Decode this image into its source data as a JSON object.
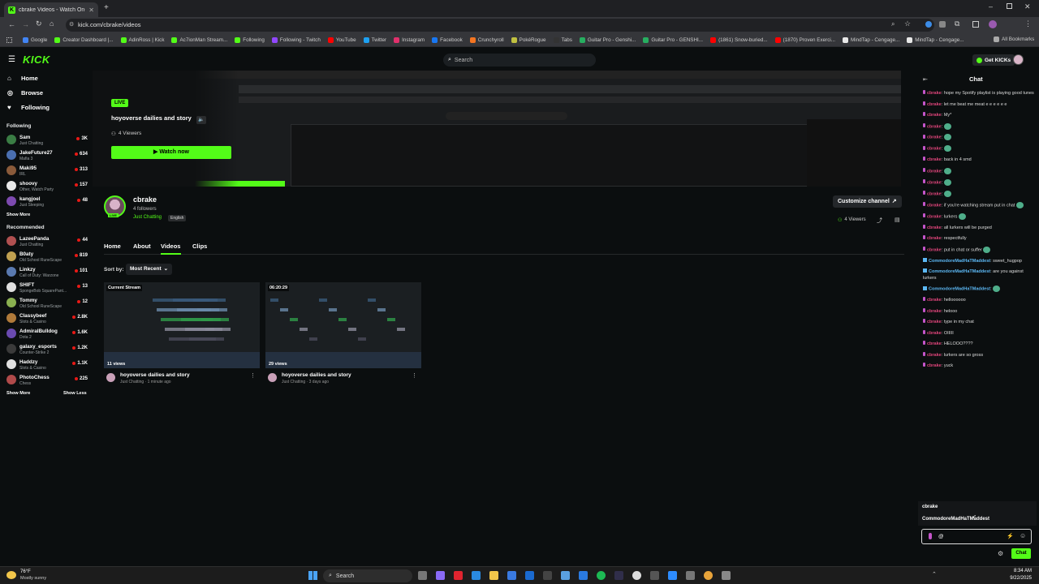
{
  "browser": {
    "tab_title": "cbrake Videos - Watch On-Der",
    "url": "kick.com/cbrake/videos",
    "bookmarks": [
      "Google",
      "Creator Dashboard |...",
      "AdinRoss | Kick",
      "Ac7ionMan Stream...",
      "Following",
      "Following - Twitch",
      "YouTube",
      "Twitter",
      "Instagram",
      "Facebook",
      "Crunchyroll",
      "PokéRogue",
      "Tabs",
      "Guitar Pro - Genshi...",
      "Guitar Pro - GENSHI...",
      "(1861) Snow-buried...",
      "(1870) Proven Exerci...",
      "MindTap - Cengage...",
      "MindTap - Cengage..."
    ],
    "all_bookmarks": "All Bookmarks"
  },
  "header": {
    "logo": "KICK",
    "search_placeholder": "Search",
    "get_kicks": "Get KICKs"
  },
  "sidebar": {
    "nav": [
      {
        "label": "Home"
      },
      {
        "label": "Browse"
      },
      {
        "label": "Following"
      }
    ],
    "following_title": "Following",
    "following": [
      {
        "name": "Sam",
        "category": "Just Chatting",
        "viewers": "3K",
        "color": "#3a7d44"
      },
      {
        "name": "JakeFuture27",
        "category": "Mafia 3",
        "viewers": "634",
        "color": "#4a6fb0"
      },
      {
        "name": "Maki95",
        "category": "IRL",
        "viewers": "313",
        "color": "#8a5a3a"
      },
      {
        "name": "shoovy",
        "category": "Other, Watch Party",
        "viewers": "157",
        "color": "#e8e8e8"
      },
      {
        "name": "kangjoel",
        "category": "Just Sleeping",
        "viewers": "48",
        "color": "#7d4ab0"
      }
    ],
    "show_more_1": "Show More",
    "recommended_title": "Recommended",
    "recommended": [
      {
        "name": "LazeePanda",
        "category": "Just Chatting",
        "viewers": "44",
        "color": "#b05050"
      },
      {
        "name": "B0aty",
        "category": "Old School RuneScape",
        "viewers": "819",
        "color": "#c0a050"
      },
      {
        "name": "Linkzy",
        "category": "Call of Duty: Warzone",
        "viewers": "101",
        "color": "#5a7ab0"
      },
      {
        "name": "SHIFT",
        "category": "SpongeBob SquarePant...",
        "viewers": "13",
        "color": "#e0e0e0"
      },
      {
        "name": "Tommy",
        "category": "Old School RuneScape",
        "viewers": "12",
        "color": "#8ab050"
      },
      {
        "name": "Classybeef",
        "category": "Slots & Casino",
        "viewers": "2.8K",
        "color": "#b07a3a"
      },
      {
        "name": "AdmiralBulldog",
        "category": "Dota 2",
        "viewers": "1.6K",
        "color": "#6a4ab0"
      },
      {
        "name": "galaxy_esports",
        "category": "Counter-Strike 2",
        "viewers": "1.2K",
        "color": "#3a3a3a"
      },
      {
        "name": "Haddzy",
        "category": "Slots & Casino",
        "viewers": "1.1K",
        "color": "#e0e0e0"
      },
      {
        "name": "PhotoChess",
        "category": "Chess",
        "viewers": "225",
        "color": "#b04a4a"
      }
    ],
    "show_more_2": "Show More",
    "show_less": "Show Less"
  },
  "banner": {
    "live": "LIVE",
    "title": "hoyoverse dailies and story",
    "viewers": "4 Viewers",
    "watch_now": "Watch now"
  },
  "channel": {
    "name": "cbrake",
    "followers": "4 followers",
    "category": "Just Chatting",
    "language": "English",
    "customize": "Customize channel",
    "viewers": "4 Viewers",
    "tabs": [
      "Home",
      "About",
      "Videos",
      "Clips"
    ],
    "sort_label": "Sort by:",
    "sort_value": "Most Recent"
  },
  "videos": [
    {
      "badge": "Current Stream",
      "views": "11 views",
      "title": "hoyoverse dailies and story",
      "meta": "Just Chatting · 1 minute ago"
    },
    {
      "badge": "06:20:29",
      "views": "29 views",
      "title": "hoyoverse dailies and story",
      "meta": "Just Chatting · 3 days ago"
    }
  ],
  "chat": {
    "title": "Chat",
    "messages": [
      {
        "user": "cbrake",
        "text": "hope my Spotify playlist is playing good tunes"
      },
      {
        "user": "cbrake",
        "text": "let me beat me meat e e e e e e"
      },
      {
        "user": "cbrake",
        "text": "My*"
      },
      {
        "user": "cbrake",
        "text": "",
        "emote": true
      },
      {
        "user": "cbrake",
        "text": "",
        "emote": true
      },
      {
        "user": "cbrake",
        "text": "",
        "emote": true
      },
      {
        "user": "cbrake",
        "text": "back in 4 smd"
      },
      {
        "user": "cbrake",
        "text": "",
        "emote": true
      },
      {
        "user": "cbrake",
        "text": "",
        "emote": true
      },
      {
        "user": "cbrake",
        "text": "",
        "emote": true
      },
      {
        "user": "cbrake",
        "text": "if you're watching stream put in chat",
        "emote": true
      },
      {
        "user": "cbrake",
        "text": "lurkers",
        "emote": true
      },
      {
        "user": "cbrake",
        "text": "all lurkers will be purged"
      },
      {
        "user": "cbrake",
        "text": "respectfully"
      },
      {
        "user": "cbrake",
        "text": "put in chat or suffer",
        "emote": true
      },
      {
        "user": "CommodoreMadHaTMaddest",
        "text": "sweet_hugpop",
        "u2": true
      },
      {
        "user": "CommodoreMadHaTMaddest",
        "text": "are you against lurkers",
        "u2": true
      },
      {
        "user": "CommodoreMadHaTMaddest",
        "text": "",
        "u2": true,
        "emote": true
      },
      {
        "user": "cbrake",
        "text": "helloooooo"
      },
      {
        "user": "cbrake",
        "text": "helooo"
      },
      {
        "user": "cbrake",
        "text": "type in my chat"
      },
      {
        "user": "cbrake",
        "text": "OIIIII"
      },
      {
        "user": "cbrake",
        "text": "HELOOO????"
      },
      {
        "user": "cbrake",
        "text": "lurkers are so gross"
      },
      {
        "user": "cbrake",
        "text": "yuck"
      }
    ],
    "mention_suggestions": [
      "cbrake",
      "CommodoreMadHaTMaddest"
    ],
    "input_value": "@",
    "send_label": "Chat"
  },
  "taskbar": {
    "weather_temp": "76°F",
    "weather_desc": "Mostly sunny",
    "search": "Search",
    "time": "8:34 AM",
    "date": "9/22/2025"
  }
}
